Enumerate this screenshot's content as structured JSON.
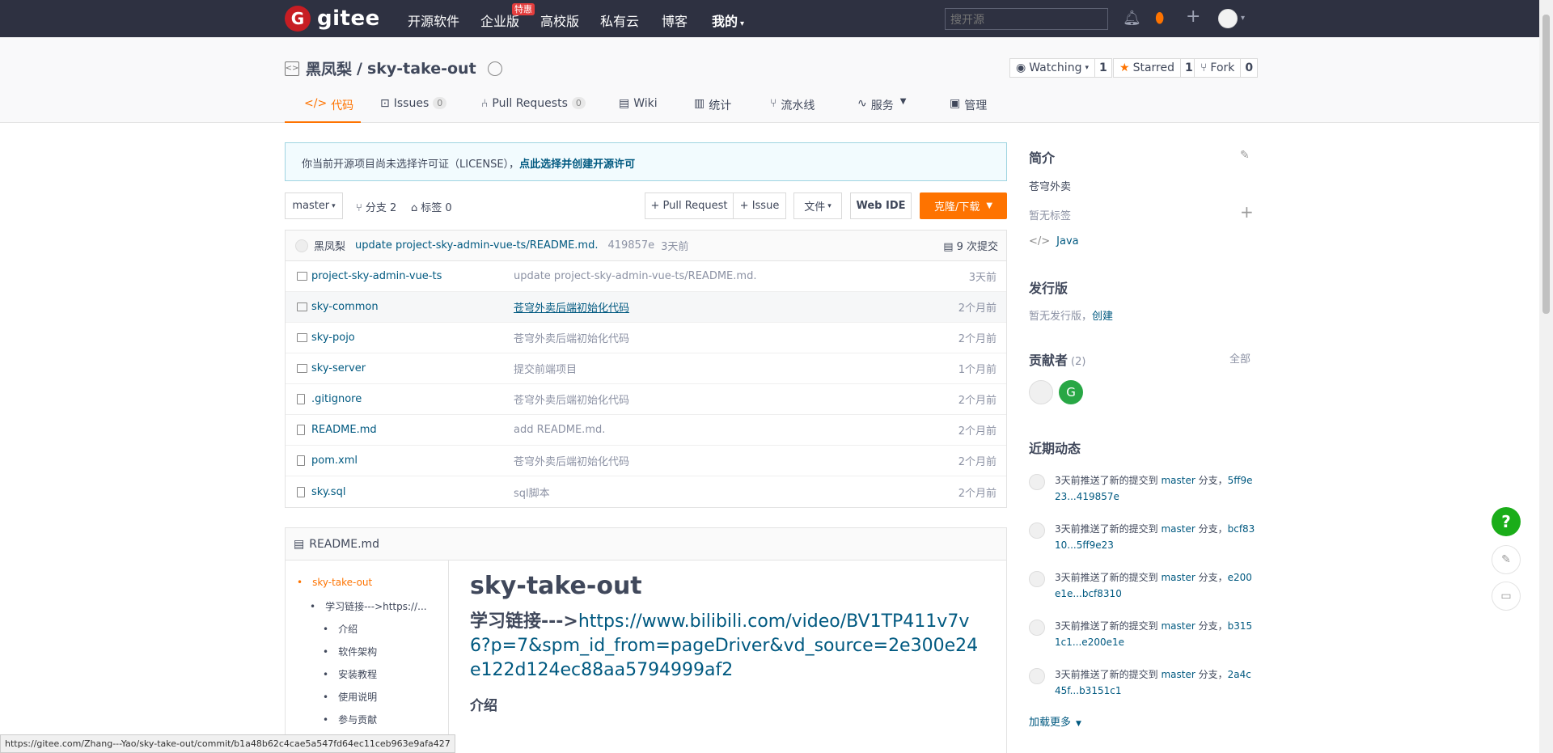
{
  "topnav": {
    "logo_mark": "G",
    "logo_text": "gitee",
    "items": [
      "开源软件",
      "企业版",
      "高校版",
      "私有云",
      "博客",
      "我的"
    ],
    "enterprise_badge": "特惠",
    "search_placeholder": "搜开源"
  },
  "project": {
    "owner": "黑凤梨",
    "separator": "/",
    "name": "sky-take-out",
    "watching_label": "Watching",
    "watching_count": "1",
    "starred_label": "Starred",
    "starred_count": "1",
    "fork_label": "Fork",
    "fork_count": "0"
  },
  "tabs": [
    {
      "label": "代码",
      "count": null
    },
    {
      "label": "Issues",
      "count": "0"
    },
    {
      "label": "Pull Requests",
      "count": "0"
    },
    {
      "label": "Wiki",
      "count": null
    },
    {
      "label": "统计",
      "count": null
    },
    {
      "label": "流水线",
      "count": null
    },
    {
      "label": "服务",
      "count": null
    },
    {
      "label": "管理",
      "count": null
    }
  ],
  "notice": {
    "text": "你当前开源项目尚未选择许可证（LICENSE），",
    "link": "点此选择并创建开源许可"
  },
  "toolbar": {
    "branch": "master",
    "branches": "分支 2",
    "tags": "标签 0",
    "pull_request": "+ Pull Request",
    "issue": "+ Issue",
    "file": "文件",
    "web_ide": "Web IDE",
    "clone": "克隆/下载"
  },
  "commit": {
    "author": "黑凤梨",
    "message": "update project-sky-admin-vue-ts/README.md.",
    "hash": "419857e",
    "time": "3天前",
    "count": "9 次提交"
  },
  "files": [
    {
      "type": "folder",
      "name": "project-sky-admin-vue-ts",
      "message": "update project-sky-admin-vue-ts/README.md.",
      "time": "3天前"
    },
    {
      "type": "folder",
      "name": "sky-common",
      "message": "苍穹外卖后端初始化代码",
      "time": "2个月前"
    },
    {
      "type": "folder",
      "name": "sky-pojo",
      "message": "苍穹外卖后端初始化代码",
      "time": "2个月前"
    },
    {
      "type": "folder",
      "name": "sky-server",
      "message": "提交前端项目",
      "time": "1个月前"
    },
    {
      "type": "file",
      "name": ".gitignore",
      "message": "苍穹外卖后端初始化代码",
      "time": "2个月前"
    },
    {
      "type": "file",
      "name": "README.md",
      "message": "add README.md.",
      "time": "2个月前"
    },
    {
      "type": "file",
      "name": "pom.xml",
      "message": "苍穹外卖后端初始化代码",
      "time": "2个月前"
    },
    {
      "type": "file",
      "name": "sky.sql",
      "message": "sql脚本",
      "time": "2个月前"
    }
  ],
  "readme": {
    "filename": "README.md",
    "toc": [
      "sky-take-out",
      "学习链接--->https://...",
      "介绍",
      "软件架构",
      "安装教程",
      "使用说明",
      "参与贡献"
    ],
    "h1": "sky-take-out",
    "h2_prefix": "学习链接--->",
    "h2_link": "https://www.bilibili.com/video/BV1TP411v7v6?p=7&spm_id_from=pageDriver&vd_source=2e300e24e122d124ec88aa5794999af2",
    "h3": "介绍"
  },
  "sidebar": {
    "intro_title": "简介",
    "intro_text": "苍穹外卖",
    "no_tags": "暂无标签",
    "language": "Java",
    "release_title": "发行版",
    "no_release": "暂无发行版，",
    "create": "创建",
    "contributors_title": "贡献者",
    "contributors_count": "(2)",
    "all": "全部",
    "contributor_initial": "G",
    "activity_title": "近期动态",
    "activities": [
      {
        "prefix": "3天前推送了新的提交到 ",
        "branch": "master",
        "mid": " 分支，",
        "range": "5ff9e23...419857e"
      },
      {
        "prefix": "3天前推送了新的提交到 ",
        "branch": "master",
        "mid": " 分支，",
        "range": "bcf8310...5ff9e23"
      },
      {
        "prefix": "3天前推送了新的提交到 ",
        "branch": "master",
        "mid": " 分支，",
        "range": "e200e1e...bcf8310"
      },
      {
        "prefix": "3天前推送了新的提交到 ",
        "branch": "master",
        "mid": " 分支，",
        "range": "b3151c1...e200e1e"
      },
      {
        "prefix": "3天前推送了新的提交到 ",
        "branch": "master",
        "mid": " 分支，",
        "range": "2a4c45f...b3151c1"
      }
    ],
    "load_more": "加载更多"
  },
  "status_url": "https://gitee.com/Zhang---Yao/sky-take-out/commit/b1a48b62c4cae5a547fd64ec11ceb963e9afa427"
}
